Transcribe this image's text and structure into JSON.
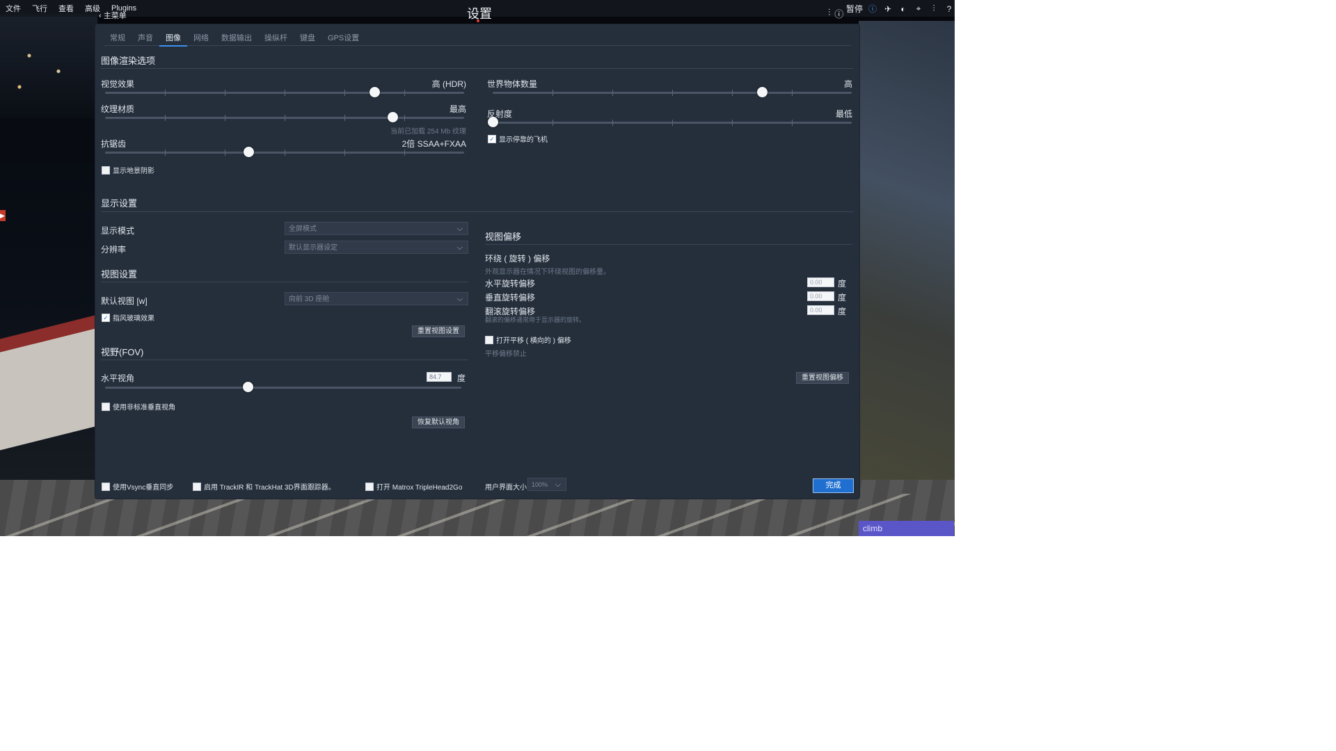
{
  "menubar": {
    "items": [
      "文件",
      "飞行",
      "查看",
      "高级",
      "Plugins"
    ],
    "home": "主菜单"
  },
  "window_title": "设置",
  "top_right": {
    "pause": "暂停"
  },
  "tabs": [
    "常规",
    "声音",
    "图像",
    "网络",
    "数据输出",
    "操纵杆",
    "键盘",
    "GPS设置"
  ],
  "active_tab_index": 2,
  "rendering": {
    "title": "图像渲染选项",
    "visual_effects": {
      "label": "视觉效果",
      "value": "高 (HDR)",
      "level": 0.75
    },
    "texture_quality": {
      "label": "纹理材质",
      "value": "最高",
      "level": 0.8,
      "hint": "当前已加载 254 Mb 纹理"
    },
    "antialiasing": {
      "label": "抗锯齿",
      "value": "2倍 SSAA+FXAA",
      "level": 0.4
    },
    "show_shadows": {
      "label": "显示地景阴影",
      "checked": false
    },
    "world_objects": {
      "label": "世界物体数量",
      "value": "高",
      "level": 0.75
    },
    "reflection": {
      "label": "反射度",
      "value": "最低",
      "level": 0.0
    },
    "draw_parked": {
      "label": "显示停靠的飞机",
      "checked": true
    }
  },
  "display": {
    "title": "显示设置",
    "mode": {
      "label": "显示模式",
      "value": "全屏模式"
    },
    "resolution": {
      "label": "分辨率",
      "value": "默认显示器设定"
    }
  },
  "view": {
    "title": "视图设置",
    "default_view": {
      "label": "默认视图 [w]",
      "value": "向前 3D 座舱"
    },
    "wind_effect": {
      "label": "指风玻璃效果",
      "checked": true
    },
    "reset_button": "重置视图设置"
  },
  "fov": {
    "title": "视野(FOV)",
    "horizontal": {
      "label": "水平视角",
      "value": "84.7",
      "unit": "度",
      "level": 0.4
    },
    "non_standard": {
      "label": "使用非标准垂直视角",
      "checked": false
    },
    "restore_button": "恢复默认视角"
  },
  "view_offset": {
    "title": "视图偏移",
    "sub_title": "环绕 ( 旋转 ) 偏移",
    "sub_hint": "外观显示器在情况下环绕视图的偏移量。",
    "horizontal": {
      "label": "水平旋转偏移",
      "value": "0.00",
      "unit": "度"
    },
    "vertical": {
      "label": "垂直旋转偏移",
      "value": "0.00",
      "unit": "度"
    },
    "roll": {
      "label": "翻滚旋转偏移",
      "value": "0.00",
      "unit": "度",
      "hint": "翻滚的偏移通常用于显示器的旋转。"
    },
    "lateral": {
      "label": "打开平移 ( 横向的 ) 偏移",
      "checked": false,
      "hint": "平移偏移禁止"
    },
    "reset_button": "重置视图偏移"
  },
  "footer": {
    "vsync": {
      "label": "使用Vsync垂直同步",
      "checked": false
    },
    "trackir": {
      "label": "启用 TrackIR 和 TrackHat 3D界面跟踪器。",
      "checked": false
    },
    "matrox": {
      "label": "打开 Matrox TripleHead2Go",
      "checked": false
    },
    "ui_size_label": "用户界面大小",
    "ui_size_value": "100%",
    "done_button": "完成"
  },
  "climb_label": "climb"
}
